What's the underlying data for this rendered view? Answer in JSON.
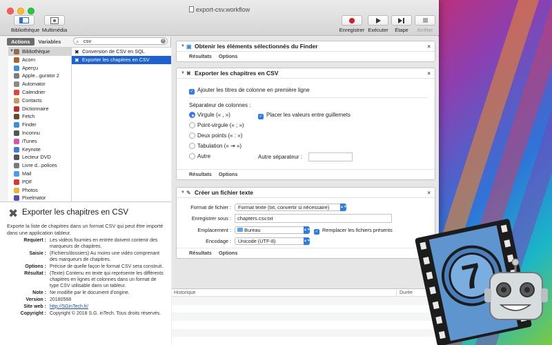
{
  "window": {
    "title": "export-csv.workflow"
  },
  "toolbar": {
    "library": "Bibliothèque",
    "media": "Multimédia",
    "record": "Enregistrer",
    "run": "Exécuter",
    "step": "Étape",
    "stop": "Arrêter"
  },
  "tabs": {
    "actions": "Actions",
    "variables": "Variables"
  },
  "search": {
    "value": "csv"
  },
  "library": {
    "root": "Bibliothèque",
    "items": [
      {
        "label": "Acorn",
        "color": "#a8642a"
      },
      {
        "label": "Aperçu",
        "color": "#3f8fd8"
      },
      {
        "label": "Apple...gurator 2",
        "color": "#7d7d7d"
      },
      {
        "label": "Automator",
        "color": "#8a8a8a"
      },
      {
        "label": "Calendrier",
        "color": "#e0463a"
      },
      {
        "label": "Contacts",
        "color": "#c99a5e"
      },
      {
        "label": "Dictionnaire",
        "color": "#b73232"
      },
      {
        "label": "Fetch",
        "color": "#6b4a2e"
      },
      {
        "label": "Finder",
        "color": "#3b8fe0"
      },
      {
        "label": "Inconnu",
        "color": "#555555"
      },
      {
        "label": "iTunes",
        "color": "#e04fae"
      },
      {
        "label": "Keynote",
        "color": "#3a7fd5"
      },
      {
        "label": "Lecteur DVD",
        "color": "#555555"
      },
      {
        "label": "Livre d...polices",
        "color": "#7a7a7a"
      },
      {
        "label": "Mail",
        "color": "#4b9be8"
      },
      {
        "label": "PDF",
        "color": "#d93a2f"
      },
      {
        "label": "Photos",
        "color": "#f0b33a"
      },
      {
        "label": "Pixelmator",
        "color": "#5a4ab8"
      }
    ]
  },
  "results": [
    {
      "label": "Conversion de CSV en SQL",
      "selected": false
    },
    {
      "label": "Exporter les chapitres en CSV",
      "selected": true
    }
  ],
  "description": {
    "title": "Exporter les chapitres en CSV",
    "intro": "Exporte la liste de chapitres dans un format CSV qui peut être importé dans une application tableur.",
    "fields": [
      {
        "k": "Requiert :",
        "v": "Les vidéos fournies en entrée doivent contenir des marqueurs de chapitres."
      },
      {
        "k": "Saisie :",
        "v": "(Fichiers/dossiers) Au moins une vidéo comprenant des marqueurs de chapitres."
      },
      {
        "k": "Options :",
        "v": "Précise de quelle façon le format CSV sera construit."
      },
      {
        "k": "Résultat :",
        "v": "(Texte) Contenu en texte qui représente les différents chapitres en lignes et colonnes dans un format de type CSV utilisable dans un tableur."
      },
      {
        "k": "Note :",
        "v": "Ne modifie par le document d'origine."
      },
      {
        "k": "Version :",
        "v": "20180568"
      },
      {
        "k": "Site web :",
        "v": "http://SGinTech.fr/"
      },
      {
        "k": "Copyright :",
        "v": "Copyright © 2018 S.G. inTech. Tous droits réservés."
      }
    ]
  },
  "cards": {
    "results_label": "Résultats",
    "options_label": "Options",
    "finder": {
      "title": "Obtenir les éléments sélectionnés du Finder"
    },
    "export": {
      "title": "Exporter les chapitres en CSV",
      "headers_check": "Ajouter les titres de colonne en première ligne",
      "separator_label": "Séparateur de colonnes :",
      "options": [
        {
          "label": "Virgule (« , »)",
          "selected": true
        },
        {
          "label": "Point-virgule (« ; »)",
          "selected": false
        },
        {
          "label": "Deux points (« : »)",
          "selected": false
        },
        {
          "label": "Tabulation (« ⇥ »)",
          "selected": false
        },
        {
          "label": "Autre",
          "selected": false
        }
      ],
      "quotes_check": "Placer les valeurs entre guillemets",
      "other_sep_label": "Autre séparateur :"
    },
    "create": {
      "title": "Créer un fichier texte",
      "format_label": "Format de fichier :",
      "format_value": "Format texte (txt, convertir si nécessaire)",
      "save_label": "Enregistrer sous :",
      "save_value": "chapters.csv.txt",
      "location_label": "Emplacement :",
      "location_value": "Bureau",
      "replace_check": "Remplacer les fichiers présents",
      "encoding_label": "Encodage :",
      "encoding_value": "Unicode (UTF-8)"
    }
  },
  "history": {
    "col1": "Historique",
    "col2": "Durée"
  }
}
